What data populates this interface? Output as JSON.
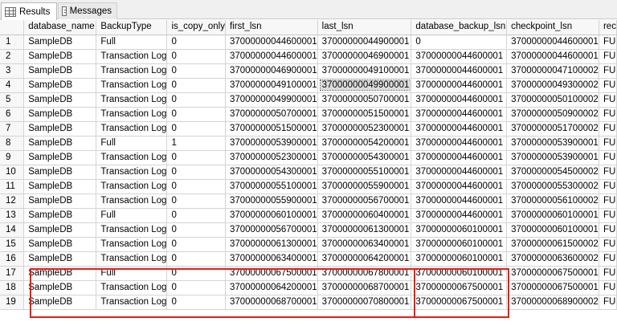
{
  "tabs": {
    "results": "Results",
    "messages": "Messages"
  },
  "grid": {
    "columns": [
      "",
      "database_name",
      "BackupType",
      "is_copy_only",
      "first_lsn",
      "last_lsn",
      "database_backup_lsn",
      "checkpoint_lsn",
      "rec"
    ],
    "rows": [
      [
        "1",
        "SampleDB",
        "Full",
        "0",
        "37000000044600001",
        "37000000044900001",
        "0",
        "37000000044600001",
        "FU"
      ],
      [
        "2",
        "SampleDB",
        "Transaction Log",
        "0",
        "37000000044600001",
        "37000000046900001",
        "37000000044600001",
        "37000000044600001",
        "FU"
      ],
      [
        "3",
        "SampleDB",
        "Transaction Log",
        "0",
        "37000000046900001",
        "37000000049100001",
        "37000000044600001",
        "37000000047100002",
        "FU"
      ],
      [
        "4",
        "SampleDB",
        "Transaction Log",
        "0",
        "37000000049100001",
        "37000000049900001",
        "37000000044600001",
        "37000000049300002",
        "FU"
      ],
      [
        "5",
        "SampleDB",
        "Transaction Log",
        "0",
        "37000000049900001",
        "37000000050700001",
        "37000000044600001",
        "37000000050100002",
        "FU"
      ],
      [
        "6",
        "SampleDB",
        "Transaction Log",
        "0",
        "37000000050700001",
        "37000000051500001",
        "37000000044600001",
        "37000000050900002",
        "FU"
      ],
      [
        "7",
        "SampleDB",
        "Transaction Log",
        "0",
        "37000000051500001",
        "37000000052300001",
        "37000000044600001",
        "37000000051700002",
        "FU"
      ],
      [
        "8",
        "SampleDB",
        "Full",
        "1",
        "37000000053900001",
        "37000000054200001",
        "37000000044600001",
        "37000000053900001",
        "FU"
      ],
      [
        "9",
        "SampleDB",
        "Transaction Log",
        "0",
        "37000000052300001",
        "37000000054300001",
        "37000000044600001",
        "37000000053900001",
        "FU"
      ],
      [
        "10",
        "SampleDB",
        "Transaction Log",
        "0",
        "37000000054300001",
        "37000000055100001",
        "37000000044600001",
        "37000000054500002",
        "FU"
      ],
      [
        "11",
        "SampleDB",
        "Transaction Log",
        "0",
        "37000000055100001",
        "37000000055900001",
        "37000000044600001",
        "37000000055300002",
        "FU"
      ],
      [
        "12",
        "SampleDB",
        "Transaction Log",
        "0",
        "37000000055900001",
        "37000000056700001",
        "37000000044600001",
        "37000000056100002",
        "FU"
      ],
      [
        "13",
        "SampleDB",
        "Full",
        "0",
        "37000000060100001",
        "37000000060400001",
        "37000000044600001",
        "37000000060100001",
        "FU"
      ],
      [
        "14",
        "SampleDB",
        "Transaction Log",
        "0",
        "37000000056700001",
        "37000000061300001",
        "37000000060100001",
        "37000000060100001",
        "FU"
      ],
      [
        "15",
        "SampleDB",
        "Transaction Log",
        "0",
        "37000000061300001",
        "37000000063400001",
        "37000000060100001",
        "37000000061500002",
        "FU"
      ],
      [
        "16",
        "SampleDB",
        "Transaction Log",
        "0",
        "37000000063400001",
        "37000000064200001",
        "37000000060100001",
        "37000000063600002",
        "FU"
      ],
      [
        "17",
        "SampleDB",
        "Full",
        "0",
        "37000000067500001",
        "37000000067800001",
        "37000000060100001",
        "37000000067500001",
        "FU"
      ],
      [
        "18",
        "SampleDB",
        "Transaction Log",
        "0",
        "37000000064200001",
        "37000000068700001",
        "37000000067500001",
        "37000000067500001",
        "FU"
      ],
      [
        "19",
        "SampleDB",
        "Transaction Log",
        "0",
        "37000000068700001",
        "37000000070800001",
        "37000000067500001",
        "37000000068900002",
        "FU"
      ]
    ]
  },
  "selected_cell": {
    "row": 3,
    "col": 5
  },
  "highlight_color": "#e0201b"
}
